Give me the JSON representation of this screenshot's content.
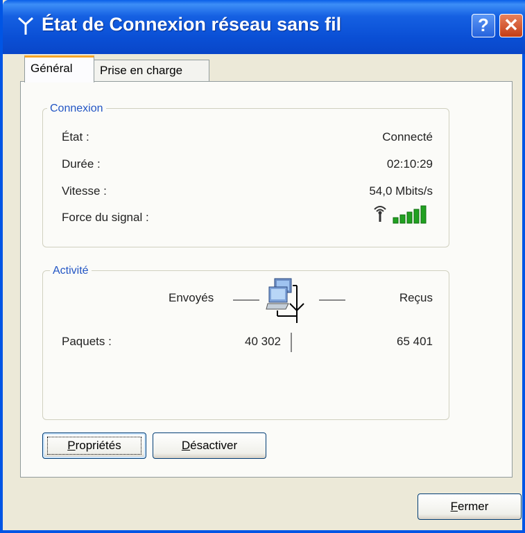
{
  "window": {
    "title": "État de Connexion réseau sans fil"
  },
  "titlebar": {
    "help_label": "?",
    "close_label": "✕"
  },
  "tabs": [
    {
      "label": "Général"
    },
    {
      "label": "Prise en charge"
    }
  ],
  "connexion": {
    "legend": "Connexion",
    "rows": [
      {
        "label": "État :",
        "value": "Connecté"
      },
      {
        "label": "Durée :",
        "value": "02:10:29"
      },
      {
        "label": "Vitesse :",
        "value": "54,0 Mbits/s"
      },
      {
        "label": "Force du signal :",
        "signal_bars": 5
      }
    ]
  },
  "activite": {
    "legend": "Activité",
    "sent_label": "Envoyés",
    "received_label": "Reçus",
    "packets_label": "Paquets :",
    "packets_sent": "40 302",
    "packets_received": "65 401"
  },
  "buttons": {
    "properties": {
      "first": "P",
      "rest": "ropriétés"
    },
    "disable": {
      "first": "D",
      "rest": "ésactiver"
    },
    "close": {
      "first": "F",
      "rest": "ermer"
    }
  },
  "colors": {
    "titlebar": "#0A4FD5",
    "signal": "#21A121",
    "legend_text": "#2255C4"
  }
}
